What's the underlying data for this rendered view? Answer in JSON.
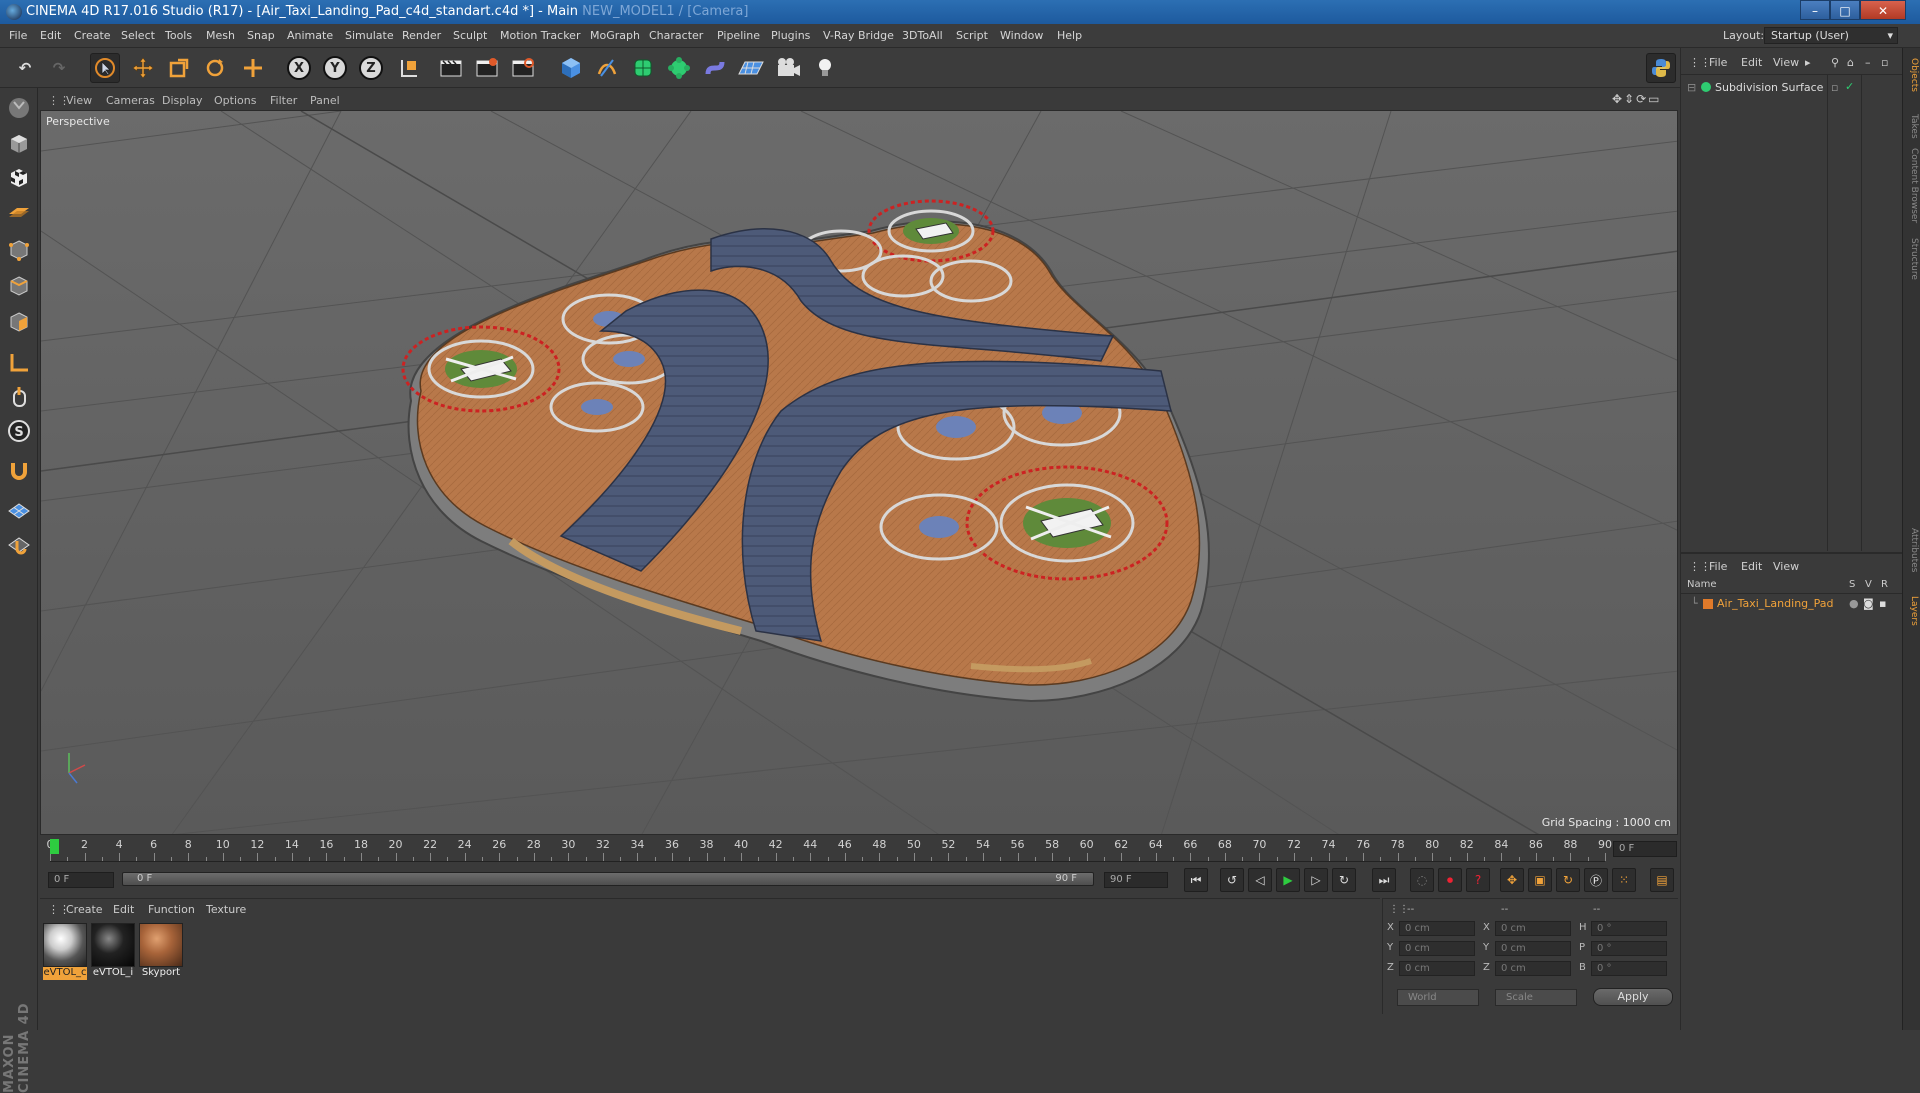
{
  "window": {
    "title": "CINEMA 4D R17.016 Studio (R17) - [Air_Taxi_Landing_Pad_c4d_standart.c4d *] - Main",
    "title_tail": "NEW_MODEL1 / [Camera]",
    "minimize": "–",
    "restore": "□",
    "close": "✕"
  },
  "menubar": {
    "items": [
      "File",
      "Edit",
      "Create",
      "Select",
      "Tools",
      "Mesh",
      "Snap",
      "Animate",
      "Simulate",
      "Render",
      "Sculpt",
      "Motion Tracker",
      "MoGraph",
      "Character",
      "Pipeline",
      "Plugins",
      "V-Ray Bridge",
      "3DToAll",
      "Script",
      "Window",
      "Help"
    ],
    "layout_label": "Layout:",
    "layout_value": "Startup (User)"
  },
  "toolbar": {
    "axis_x": "X",
    "axis_y": "Y",
    "axis_z": "Z",
    "icons": [
      "undo-icon",
      "redo-icon",
      "select-cursor-icon",
      "move-icon",
      "scale-icon",
      "rotate-icon",
      "live-select-icon",
      "axis-x-lock",
      "axis-y-lock",
      "axis-z-lock",
      "coordinate-system-icon",
      "render-view-icon",
      "render-picture-viewer-icon",
      "render-settings-icon",
      "cube-icon",
      "pen-icon",
      "subdivision-icon",
      "array-icon",
      "deformer-icon",
      "floor-icon",
      "camera-icon",
      "light-icon",
      "python-icon"
    ]
  },
  "viewport": {
    "menu": [
      "View",
      "Cameras",
      "Display",
      "Options",
      "Filter",
      "Panel"
    ],
    "label": "Perspective",
    "grid_spacing": "Grid Spacing : 1000 cm"
  },
  "timeline": {
    "ticks": [
      "0",
      "2",
      "4",
      "6",
      "8",
      "10",
      "12",
      "14",
      "16",
      "18",
      "20",
      "22",
      "24",
      "26",
      "28",
      "30",
      "32",
      "34",
      "36",
      "38",
      "40",
      "42",
      "44",
      "46",
      "48",
      "50",
      "52",
      "54",
      "56",
      "58",
      "60",
      "62",
      "64",
      "66",
      "68",
      "70",
      "72",
      "74",
      "76",
      "78",
      "80",
      "82",
      "84",
      "86",
      "88",
      "90"
    ],
    "current_frame": "0 F",
    "start_field": "0 F",
    "slider_start": "0 F",
    "slider_end": "90 F",
    "end_field": "90 F"
  },
  "materials": {
    "menu": [
      "Create",
      "Edit",
      "Function",
      "Texture"
    ],
    "items": [
      {
        "label": "eVTOL_c",
        "selected": true
      },
      {
        "label": "eVTOL_i",
        "selected": false
      },
      {
        "label": "Skyport",
        "selected": false
      }
    ]
  },
  "coordinates": {
    "header": [
      "--",
      "--",
      "--"
    ],
    "rows": [
      {
        "a": "X",
        "av": "0 cm",
        "b": "X",
        "bv": "0 cm",
        "c": "H",
        "cv": "0 °"
      },
      {
        "a": "Y",
        "av": "0 cm",
        "b": "Y",
        "bv": "0 cm",
        "c": "P",
        "cv": "0 °"
      },
      {
        "a": "Z",
        "av": "0 cm",
        "b": "Z",
        "bv": "0 cm",
        "c": "B",
        "cv": "0 °"
      }
    ],
    "mode": "World",
    "scale": "Scale",
    "apply": "Apply"
  },
  "objects": {
    "menu": [
      "File",
      "Edit",
      "View"
    ],
    "items": [
      {
        "name": "Subdivision Surface"
      }
    ]
  },
  "layers": {
    "menu": [
      "File",
      "Edit",
      "View"
    ],
    "columns": {
      "name": "Name",
      "s": "S",
      "v": "V",
      "r": "R"
    },
    "items": [
      {
        "name": "Air_Taxi_Landing_Pad",
        "color": "#e07a2a"
      }
    ]
  },
  "side_tabs": [
    "Objects",
    "Takes",
    "Content Browser",
    "Structure",
    "Attributes",
    "Layers"
  ],
  "branding": "MAXON CINEMA 4D",
  "colors": {
    "accent": "#f0a23a",
    "viewport_bg": "#5f5f5f",
    "pad_orange": "#b87a48",
    "roof_blue": "#4f5f80",
    "playhead": "#2ecc40"
  }
}
